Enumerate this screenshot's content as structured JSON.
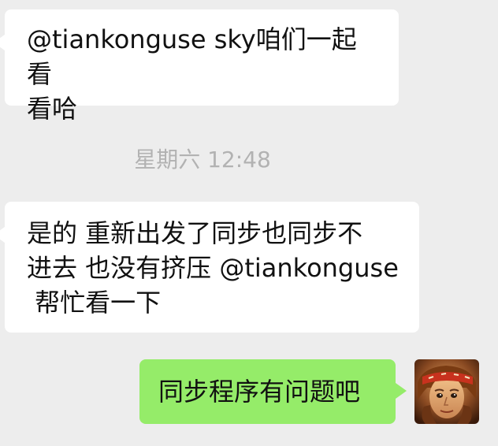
{
  "messages": [
    {
      "direction": "incoming",
      "lines": [
        "@tiankonguse sky咱们一起看",
        "看哈"
      ]
    },
    {
      "direction": "incoming",
      "lines": [
        "是的 重新出发了同步也同步不",
        "进去 也没有挤压 @tiankonguse",
        " 帮忙看一下"
      ]
    },
    {
      "direction": "outgoing",
      "lines": [
        "同步程序有问题吧"
      ],
      "avatar": "avatar-icon"
    }
  ],
  "timestamp": "星期六 12:48",
  "colors": {
    "background": "#ededed",
    "incoming_bubble": "#ffffff",
    "outgoing_bubble": "#95ec69",
    "timestamp_text": "#b2b2b2",
    "message_text": "#111111"
  }
}
